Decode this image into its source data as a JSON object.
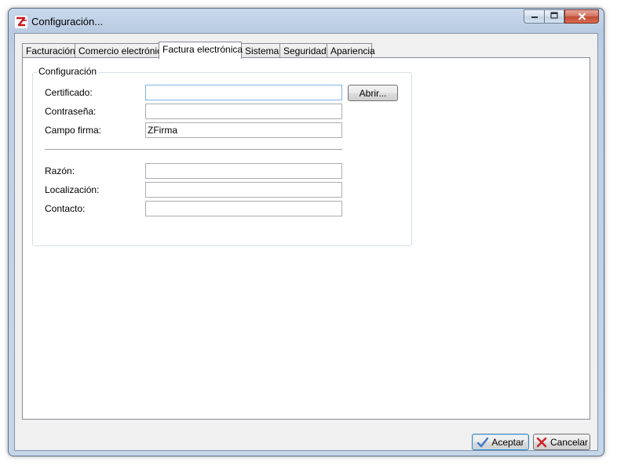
{
  "window": {
    "title": "Configuración..."
  },
  "tabs": [
    {
      "label": "Facturación"
    },
    {
      "label": "Comercio electrónico"
    },
    {
      "label": "Factura electrónica"
    },
    {
      "label": "Sistema"
    },
    {
      "label": "Seguridad"
    },
    {
      "label": "Apariencia"
    }
  ],
  "active_tab": "Factura electrónica",
  "group": {
    "title": "Configuración"
  },
  "fields": {
    "certificado": {
      "label": "Certificado:",
      "value": ""
    },
    "contrasena": {
      "label": "Contraseña:",
      "value": ""
    },
    "campo_firma": {
      "label": "Campo firma:",
      "value": "ZFirma"
    },
    "razon": {
      "label": "Razón:",
      "value": ""
    },
    "localizacion": {
      "label": "Localización:",
      "value": ""
    },
    "contacto": {
      "label": "Contacto:",
      "value": ""
    }
  },
  "buttons": {
    "abrir": "Abrir...",
    "aceptar": "Aceptar",
    "cancelar": "Cancelar"
  },
  "icons": {
    "app": "zeus-app-icon",
    "accept": "checkmark-icon",
    "cancel": "red-x-icon",
    "minimize": "minimize-icon",
    "maximize": "maximize-icon",
    "close": "close-icon"
  },
  "colors": {
    "accept_check": "#3a78c9",
    "cancel_x": "#d32020",
    "close_button": "#c14a34"
  }
}
